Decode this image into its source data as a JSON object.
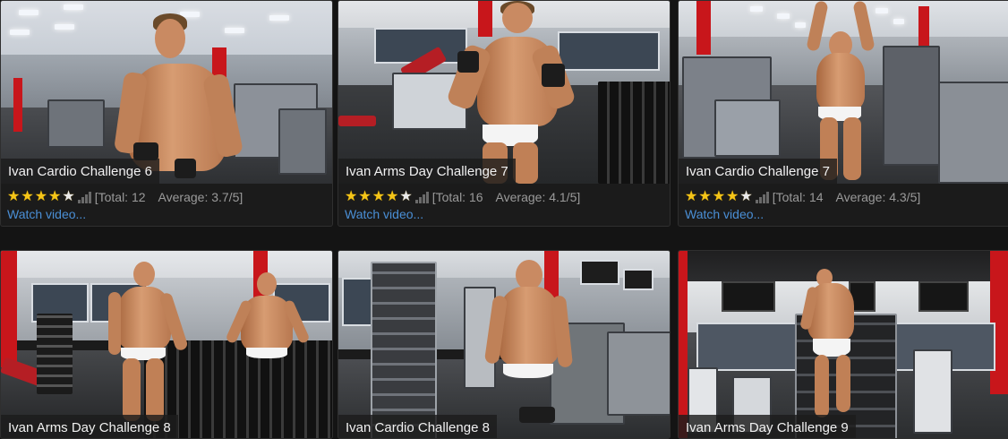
{
  "videos": [
    {
      "title": "Ivan Cardio Challenge 6",
      "rating": {
        "stars_filled": 4,
        "stars_total": 5,
        "total_label": "[Total:",
        "total": "12",
        "average_label": "Average:",
        "average": "3.7/5]"
      },
      "link": "Watch video..."
    },
    {
      "title": "Ivan Arms Day Challenge 7",
      "rating": {
        "stars_filled": 4,
        "stars_total": 5,
        "total_label": "[Total:",
        "total": "16",
        "average_label": "Average:",
        "average": "4.1/5]"
      },
      "link": "Watch video..."
    },
    {
      "title": "Ivan Cardio Challenge 7",
      "rating": {
        "stars_filled": 4,
        "stars_total": 5,
        "total_label": "[Total:",
        "total": "14",
        "average_label": "Average:",
        "average": "4.3/5]"
      },
      "link": "Watch video..."
    },
    {
      "title": "Ivan Arms Day Challenge 8"
    },
    {
      "title": "Ivan Cardio Challenge 8"
    },
    {
      "title": "Ivan Arms Day Challenge 9"
    }
  ],
  "colors": {
    "background": "#141414",
    "card": "#1b1b1b",
    "star": "#f5c518",
    "link": "#4a8fd6",
    "gym_red": "#c8161b"
  }
}
